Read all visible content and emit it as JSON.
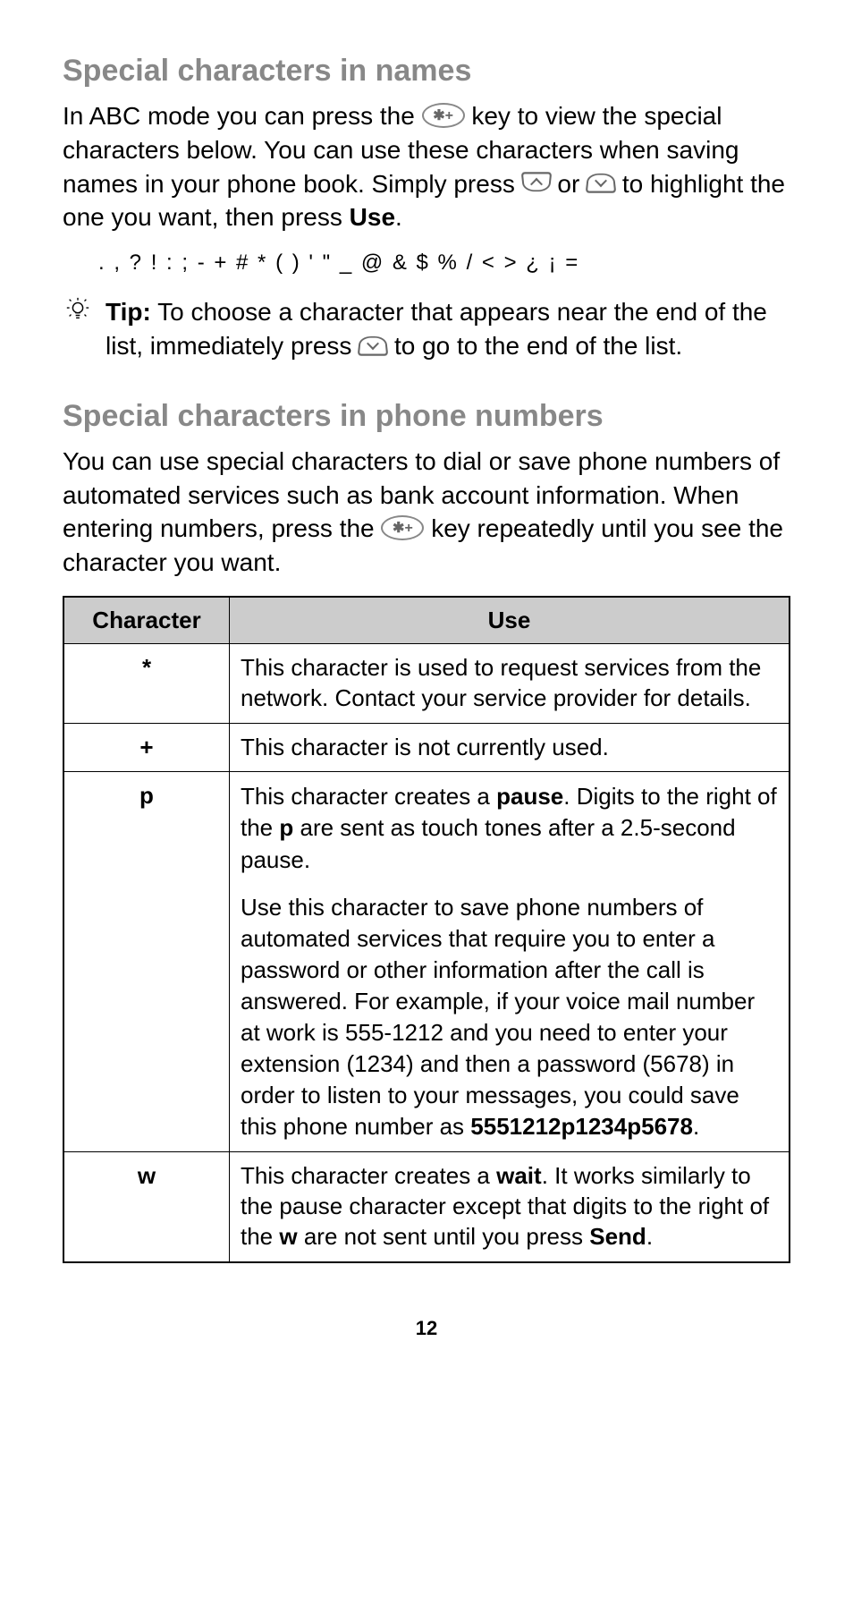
{
  "section1": {
    "heading": "Special characters in names",
    "para_before_key": "In ABC mode you can press the ",
    "para_after_key_1": " key to view the special characters below. You can use these characters when saving names in your phone book. Simply press ",
    "para_mid_or": " or ",
    "para_after_nav": " to highlight the one you want, then press ",
    "use_label": "Use",
    "para_end": ".",
    "chars": ". , ? ! : ; - + # * ( ) ' \" _ @ & $ % / < > ¿ ¡ =",
    "tip_label": "Tip:",
    "tip_text_1": " To choose a character that appears near the end of the list, immediately press ",
    "tip_text_2": " to go to the end of the list."
  },
  "section2": {
    "heading": "Special characters in phone numbers",
    "para_before": "You can use special characters to dial or save phone numbers of automated services such as bank account information. When entering numbers, press the ",
    "para_after": " key repeatedly until you see the character you want."
  },
  "table": {
    "headers": {
      "col1": "Character",
      "col2": "Use"
    },
    "rows": [
      {
        "char": "*",
        "use": [
          "This character is used to request services from the network. Contact your service provider for details."
        ]
      },
      {
        "char": "+",
        "use": [
          "This character is not currently used."
        ]
      },
      {
        "char": "p",
        "use_p": {
          "p1_a": "This character creates a ",
          "p1_b": "pause",
          "p1_c": ". Digits to the right of the ",
          "p1_d": "p",
          "p1_e": " are sent as touch tones after a 2.5-second pause.",
          "p2_a": "Use this character to save phone numbers of automated services that require you to enter a password or other information after the call is answered. For example, if your voice mail number at work is 555-1212 and you need to enter your extension (1234) and then a password (5678) in order to listen to your messages, you could save this phone number as ",
          "p2_b": "5551212p1234p5678",
          "p2_c": "."
        }
      },
      {
        "char": "w",
        "use_w": {
          "a": "This character creates a ",
          "b": "wait",
          "c": ". It works similarly to the pause character except that digits to the right of the ",
          "d": "w",
          "e": " are not sent until you press ",
          "f": "Send",
          "g": "."
        }
      }
    ]
  },
  "page_number": "12",
  "key_star": "✱+"
}
